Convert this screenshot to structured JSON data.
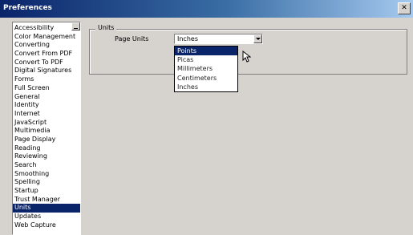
{
  "window": {
    "title": "Preferences"
  },
  "categories": {
    "items": [
      "Accessibility",
      "Color Management",
      "Converting",
      "Convert From PDF",
      "Convert To PDF",
      "Digital Signatures",
      "Forms",
      "Full Screen",
      "General",
      "Identity",
      "Internet",
      "JavaScript",
      "Multimedia",
      "Page Display",
      "Reading",
      "Reviewing",
      "Search",
      "Smoothing",
      "Spelling",
      "Startup",
      "Trust Manager",
      "Units",
      "Updates",
      "Web Capture"
    ],
    "selected": "Units"
  },
  "units_panel": {
    "group_title": "Units",
    "page_units_label": "Page Units",
    "page_units_value": "Inches",
    "options": [
      "Points",
      "Picas",
      "Millimeters",
      "Centimeters",
      "Inches"
    ],
    "highlighted_option": "Points"
  },
  "colors": {
    "selection": "#0a246a",
    "dialog_bg": "#d6d3ce",
    "titlebar_start": "#0a246a",
    "titlebar_end": "#a6caf0"
  }
}
